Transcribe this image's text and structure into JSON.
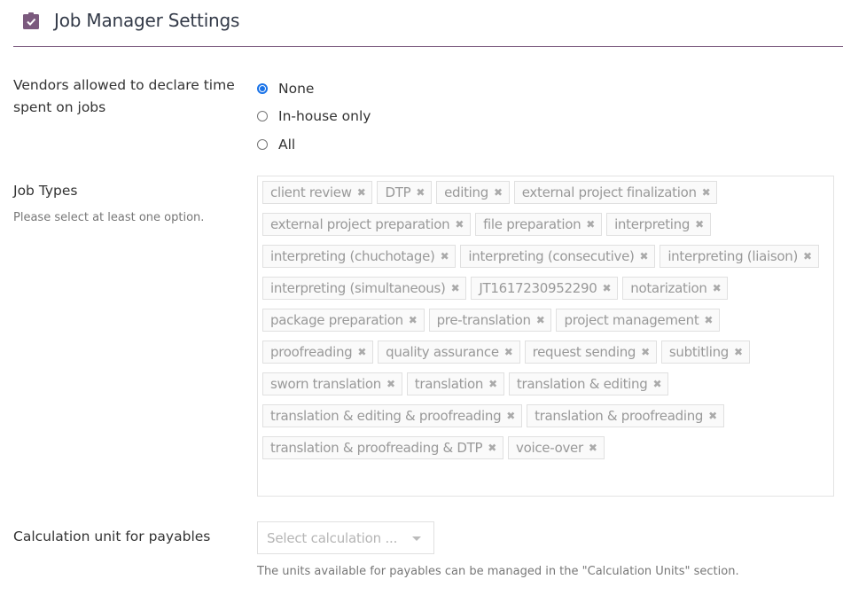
{
  "header": {
    "title": "Job Manager Settings",
    "icon": "clipboard-check-icon",
    "accent_color": "#7b5a7e"
  },
  "vendors_time": {
    "label": "Vendors allowed to declare time spent on jobs",
    "options": [
      {
        "label": "None",
        "checked": true
      },
      {
        "label": "In-house only",
        "checked": false
      },
      {
        "label": "All",
        "checked": false
      }
    ]
  },
  "job_types": {
    "label": "Job Types",
    "help": "Please select at least one option.",
    "remove_glyph": "✖",
    "tags": [
      "client review",
      "DTP",
      "editing",
      "external project finalization",
      "external project preparation",
      "file preparation",
      "interpreting",
      "interpreting (chuchotage)",
      "interpreting (consecutive)",
      "interpreting (liaison)",
      "interpreting (simultaneous)",
      "JT1617230952290",
      "notarization",
      "package preparation",
      "pre-translation",
      "project management",
      "proofreading",
      "quality assurance",
      "request sending",
      "subtitling",
      "sworn translation",
      "translation",
      "translation & editing",
      "translation & editing & proofreading",
      "translation & proofreading",
      "translation & proofreading & DTP",
      "voice-over"
    ]
  },
  "calc_unit": {
    "label": "Calculation unit for payables",
    "placeholder": "Select calculation ...",
    "help": "The units available for payables can be managed in the \"Calculation Units\" section."
  }
}
